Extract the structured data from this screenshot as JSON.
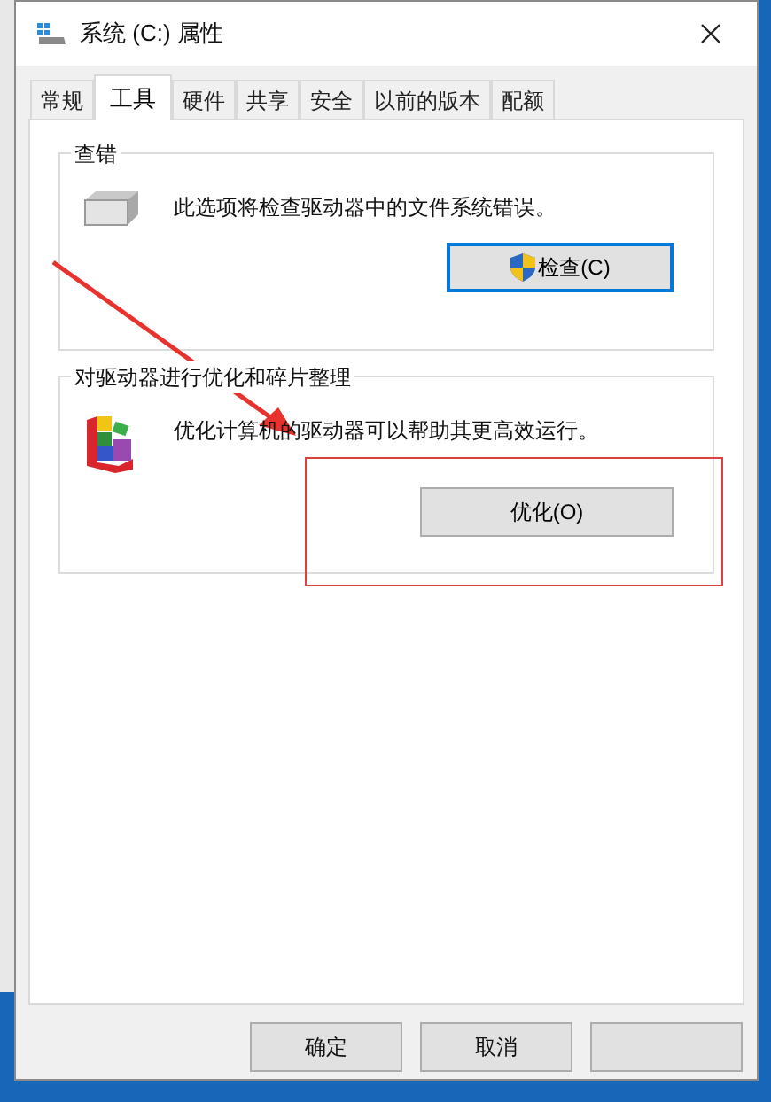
{
  "window": {
    "title": "系统 (C:) 属性"
  },
  "tabs": [
    {
      "label": "常规",
      "selected": false
    },
    {
      "label": "工具",
      "selected": true
    },
    {
      "label": "硬件",
      "selected": false
    },
    {
      "label": "共享",
      "selected": false
    },
    {
      "label": "安全",
      "selected": false
    },
    {
      "label": "以前的版本",
      "selected": false
    },
    {
      "label": "配额",
      "selected": false
    }
  ],
  "groups": [
    {
      "title": "查错",
      "description": "此选项将检查驱动器中的文件系统错误。",
      "button": {
        "label": "检查(C)",
        "shield": true,
        "focused": true
      }
    },
    {
      "title": "对驱动器进行优化和碎片整理",
      "description": "优化计算机的驱动器可以帮助其更高效运行。",
      "button": {
        "label": "优化(O)",
        "shield": false,
        "focused": false
      }
    }
  ],
  "buttons": [
    {
      "label": "确定"
    },
    {
      "label": "取消"
    }
  ]
}
